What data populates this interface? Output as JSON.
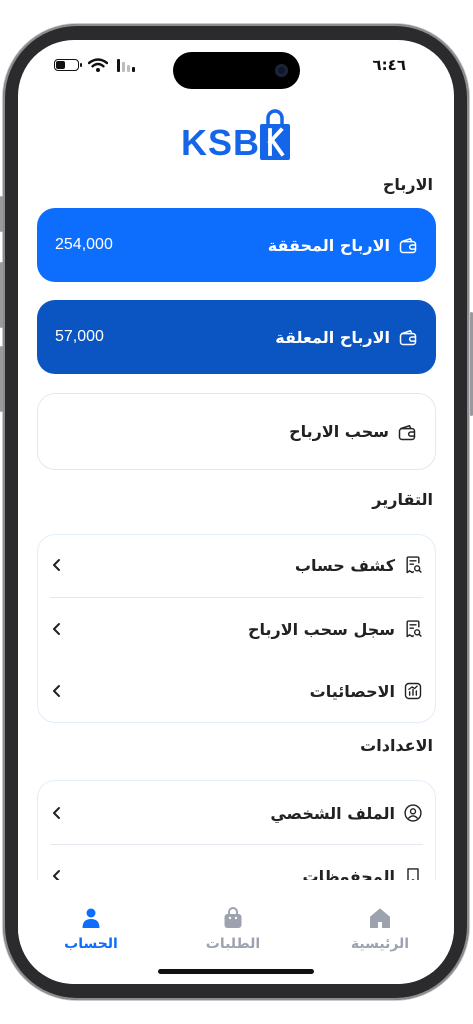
{
  "status": {
    "time": "٦:٤٦"
  },
  "brand": {
    "logo_text": "KSB",
    "accent": "#0d6efd",
    "accent_dark": "#0a55c2"
  },
  "earnings": {
    "title": "الارباح",
    "realized": {
      "label": "الارباح المحققة",
      "value": "254,000"
    },
    "pending": {
      "label": "الارباح المعلقة",
      "value": "57,000"
    },
    "withdraw": {
      "label": "سحب الارباح"
    }
  },
  "reports": {
    "title": "التقارير",
    "items": [
      {
        "label": "كشف حساب",
        "icon": "receipt-search-icon"
      },
      {
        "label": "سجل سحب الارباح",
        "icon": "receipt-search-icon"
      },
      {
        "label": "الاحصائيات",
        "icon": "chart-icon"
      }
    ]
  },
  "settings": {
    "title": "الاعدادات",
    "items": [
      {
        "label": "الملف الشخصي",
        "icon": "user-circle-icon"
      },
      {
        "label": "المحفوظات",
        "icon": "bookmark-icon"
      }
    ]
  },
  "tabbar": {
    "items": [
      {
        "label": "الحساب",
        "icon": "person-icon",
        "active": true
      },
      {
        "label": "الطلبات",
        "icon": "shopping-bag-icon",
        "active": false
      },
      {
        "label": "الرئيسية",
        "icon": "home-icon",
        "active": false
      }
    ]
  }
}
